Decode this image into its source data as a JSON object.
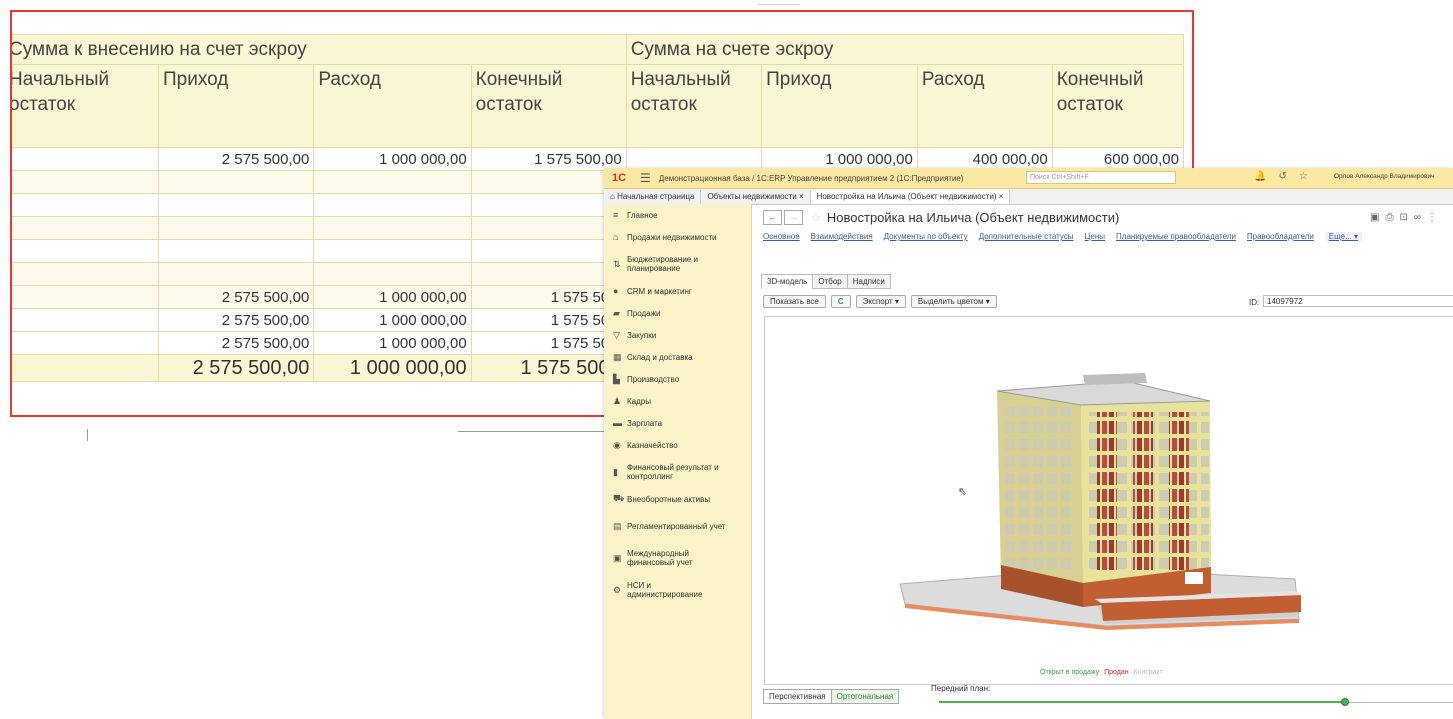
{
  "sheet": {
    "group1": "Сумма к внесению на счет эскроу",
    "group2": "Сумма на счете эскроу",
    "col_start": "Начальный остаток",
    "col_in": "Приход",
    "col_out": "Расход",
    "col_end": "Конечный остаток",
    "row1": {
      "a_in": "2 575 500,00",
      "a_out": "1 000 000,00",
      "a_end": "1 575 500,00",
      "b_in": "1 000 000,00",
      "b_out": "400 000,00",
      "b_end": "600 000,00"
    },
    "sum_rows": [
      {
        "in": "2 575 500,00",
        "out": "1 000 000,00",
        "end": "1 575 500,"
      },
      {
        "in": "2 575 500,00",
        "out": "1 000 000,00",
        "end": "1 575 500,"
      },
      {
        "in": "2 575 500,00",
        "out": "1 000 000,00",
        "end": "1 575 500,"
      }
    ],
    "total": {
      "in": "2 575 500,00",
      "out": "1 000 000,00",
      "end": "1 575 500,("
    }
  },
  "app": {
    "logo": "1С",
    "title": "Демонстрационная база / 1С:ERP Управление предприятием 2 (1С:Предприятие)",
    "search_placeholder": "Поиск Ctrl+Shift+F",
    "user": "Орлов Александр Владимирович",
    "tabs": [
      "Начальная страница",
      "Объекты недвижимости ×",
      "Новостройка на Ильича (Объект недвижимости) ×"
    ]
  },
  "sidebar": {
    "items": [
      {
        "label": "Главное",
        "icon": "menu-icon"
      },
      {
        "label": "Продажи недвижимости",
        "icon": "house-icon"
      },
      {
        "label": "Бюджетирование и планирование",
        "icon": "budget-icon"
      },
      {
        "label": "CRM и маркетинг",
        "icon": "crm-icon"
      },
      {
        "label": "Продажи",
        "icon": "bag-icon"
      },
      {
        "label": "Закупки",
        "icon": "cart-icon"
      },
      {
        "label": "Склад и доставка",
        "icon": "warehouse-icon"
      },
      {
        "label": "Производство",
        "icon": "factory-icon"
      },
      {
        "label": "Кадры",
        "icon": "person-icon"
      },
      {
        "label": "Зарплата",
        "icon": "money-icon"
      },
      {
        "label": "Казначейство",
        "icon": "treasury-icon"
      },
      {
        "label": "Финансовый результат и контроллинг",
        "icon": "chart-icon"
      },
      {
        "label": "Внеоборотные активы",
        "icon": "car-icon"
      },
      {
        "label": "Регламентированный учет",
        "icon": "doc-icon"
      },
      {
        "label": "Международный финансовый учет",
        "icon": "book-icon"
      },
      {
        "label": "НСИ и администрирование",
        "icon": "gear-icon"
      }
    ]
  },
  "object": {
    "title": "Новостройка на Ильича (Объект недвижимости)",
    "links": [
      "Основное",
      "Взаимодействия",
      "Документы по объекту",
      "Дополнительные статусы",
      "Цены",
      "Планируемые правообладатели",
      "Правообладатели"
    ],
    "more": "Еще... ▾",
    "subtabs": [
      "3D-модель",
      "Отбор",
      "Надписи"
    ],
    "buttons": {
      "show_all": "Показать все",
      "export": "Экспорт ▾",
      "highlight": "Выделить цветом ▾"
    },
    "id_label": "ID:",
    "id_value": "14097972",
    "legend": {
      "open": "Открыт в продажу",
      "sold": "Продан",
      "contract": "Контракт"
    },
    "view_tabs": [
      "Перспективная",
      "Ортогональная"
    ],
    "front_plan_label": "Передний план:",
    "front_plan_value": 0.78
  }
}
